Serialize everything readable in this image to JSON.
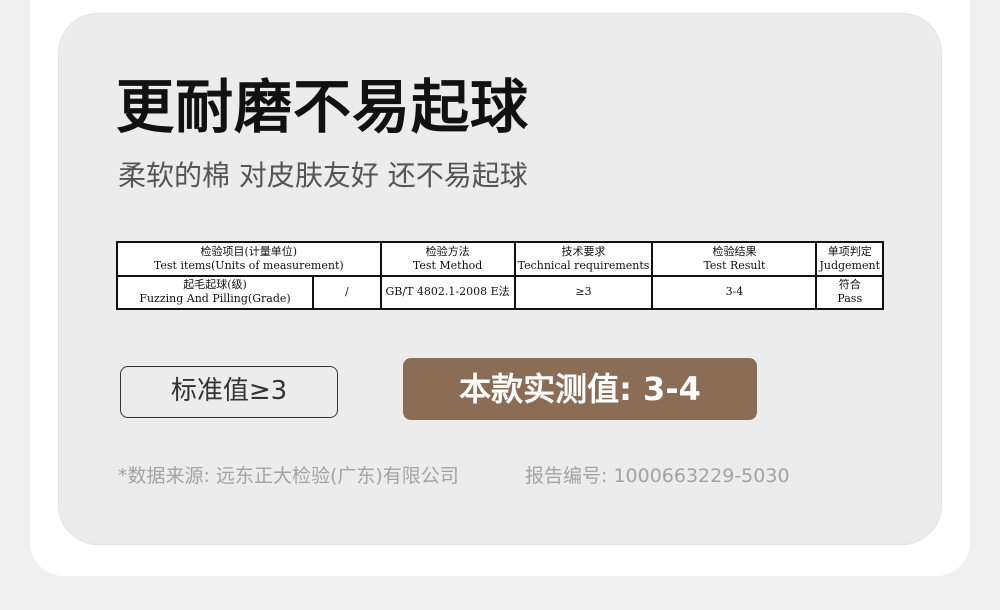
{
  "heading": {
    "title": "更耐磨不易起球",
    "subtitle": "柔软的棉 对皮肤友好 还不易起球"
  },
  "table": {
    "headers": [
      {
        "zh": "检验项目(计量单位)",
        "en": "Test items(Units of measurement)"
      },
      {
        "zh": "检验方法",
        "en": "Test Method"
      },
      {
        "zh": "技术要求",
        "en": "Technical requirements"
      },
      {
        "zh": "检验结果",
        "en": "Test Result"
      },
      {
        "zh": "单项判定",
        "en": "Judgement"
      }
    ],
    "row": {
      "item_zh": "起毛起球(级)",
      "item_en": "Fuzzing And Pilling(Grade)",
      "unit": "/",
      "method": "GB/T 4802.1-2008 E法",
      "requirement": "≥3",
      "result": "3-4",
      "judgement_zh": "符合",
      "judgement_en": "Pass"
    }
  },
  "standard_label": "标准值≥3",
  "result_label": "本款实测值: 3-4",
  "footer": {
    "source": "*数据来源: 远东正大检验(广东)有限公司",
    "report": "报告编号: 1000663229-5030"
  },
  "colors": {
    "accent_brown": "#8b6c55",
    "card_bg": "#ececec",
    "footnote_gray": "#a3a3a3"
  }
}
